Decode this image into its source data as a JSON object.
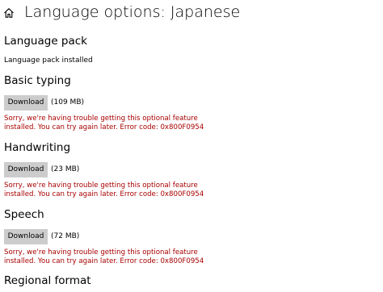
{
  "header": {
    "title": "Language options: Japanese",
    "home_icon": "home-icon"
  },
  "colors": {
    "error": "#a80000",
    "button_bg": "#cccccc"
  },
  "language_pack": {
    "title": "Language pack",
    "status": "Language pack installed"
  },
  "basic_typing": {
    "title": "Basic typing",
    "button_label": "Download",
    "size": "(109 MB)",
    "error": "Sorry, we're having trouble getting this optional feature installed. You can try again later. Error code: 0x800F0954"
  },
  "handwriting": {
    "title": "Handwriting",
    "button_label": "Download",
    "size": "(23 MB)",
    "error": "Sorry, we're having trouble getting this optional feature installed. You can try again later. Error code: 0x800F0954"
  },
  "speech": {
    "title": "Speech",
    "button_label": "Download",
    "size": "(72 MB)",
    "error": "Sorry, we're having trouble getting this optional feature installed. You can try again later. Error code: 0x800F0954"
  },
  "regional_format": {
    "title": "Regional format"
  }
}
